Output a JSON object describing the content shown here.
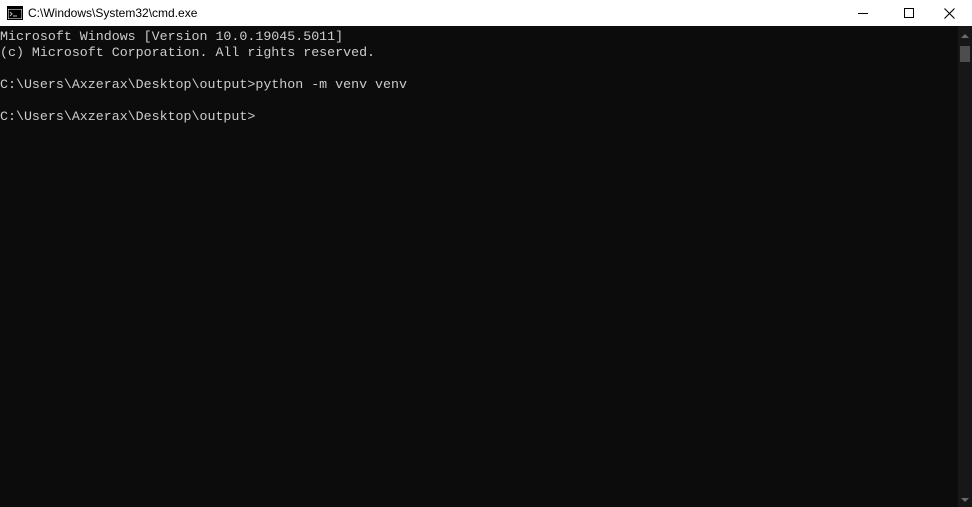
{
  "window": {
    "title": "C:\\Windows\\System32\\cmd.exe",
    "icon": "cmd-icon",
    "controls": {
      "minimize": "minimize-icon",
      "maximize": "maximize-icon",
      "close": "close-icon"
    }
  },
  "console": {
    "lines": [
      "Microsoft Windows [Version 10.0.19045.5011]",
      "(c) Microsoft Corporation. All rights reserved.",
      "C:\\Users\\Axzerax\\Desktop\\output>python -m venv venv",
      "C:\\Users\\Axzerax\\Desktop\\output>"
    ]
  },
  "colors": {
    "background": "#0c0c0c",
    "text": "#cccccc",
    "titlebar": "#ffffff"
  }
}
